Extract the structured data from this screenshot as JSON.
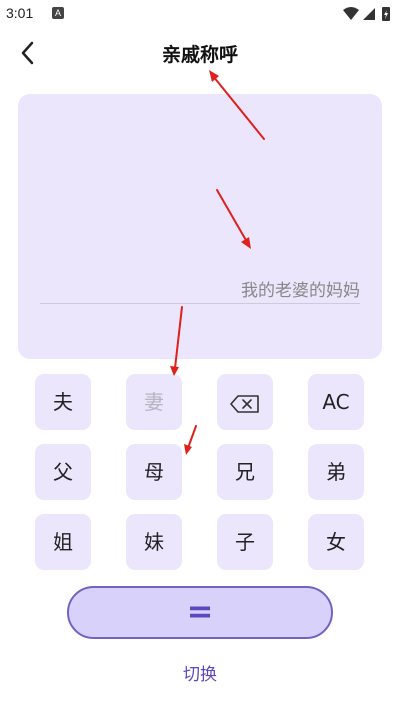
{
  "status_bar": {
    "time": "3:01",
    "notification_letter": "A"
  },
  "header": {
    "title": "亲戚称呼"
  },
  "display": {
    "result_text": "我的老婆的妈妈"
  },
  "keypad": {
    "row1": [
      "夫",
      "妻",
      "",
      "AC"
    ],
    "row2": [
      "父",
      "母",
      "兄",
      "弟"
    ],
    "row3": [
      "姐",
      "妹",
      "子",
      "女"
    ]
  },
  "equals_label": "=",
  "switch_label": "切换",
  "colors": {
    "accent": "#5b48c0",
    "key_bg": "#ebe6fb",
    "annotation_arrow": "#e0201c"
  },
  "icons": {
    "back": "chevron-left-icon",
    "backspace": "backspace-icon",
    "wifi": "wifi-icon",
    "signal": "signal-icon",
    "battery": "battery-icon"
  }
}
